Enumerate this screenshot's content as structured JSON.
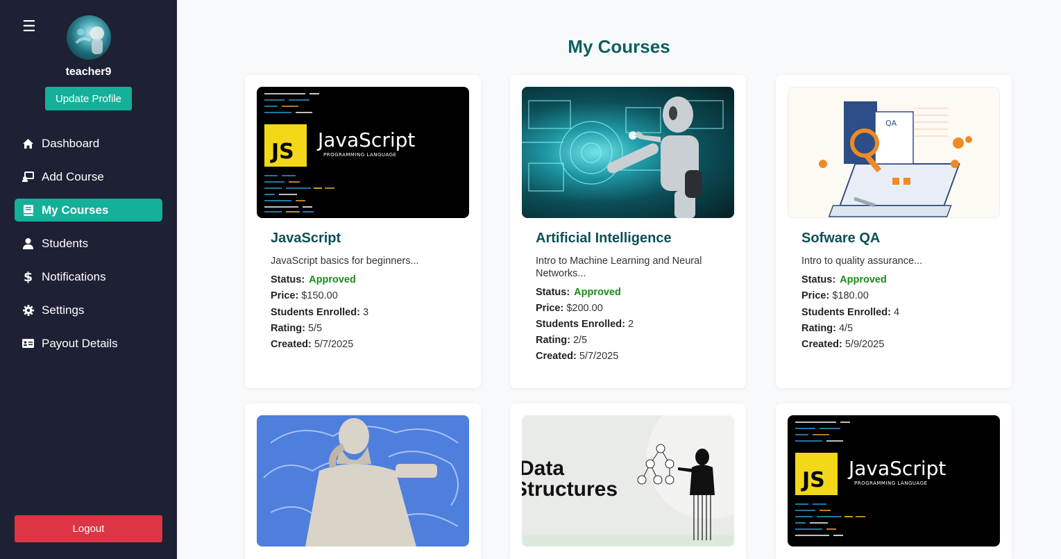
{
  "sidebar": {
    "username": "teacher9",
    "update_profile": "Update Profile",
    "items": [
      {
        "label": "Dashboard",
        "icon": "home-icon"
      },
      {
        "label": "Add Course",
        "icon": "add-course-icon"
      },
      {
        "label": "My Courses",
        "icon": "book-icon",
        "active": true
      },
      {
        "label": "Students",
        "icon": "user-icon"
      },
      {
        "label": "Notifications",
        "icon": "dollar-icon"
      },
      {
        "label": "Settings",
        "icon": "gear-icon"
      },
      {
        "label": "Payout Details",
        "icon": "id-card-icon"
      }
    ],
    "logout": "Logout"
  },
  "main": {
    "title": "My Courses",
    "labels": {
      "status": "Status:",
      "price": "Price:",
      "students": "Students Enrolled:",
      "rating": "Rating:",
      "created": "Created:"
    },
    "courses": [
      {
        "title": "JavaScript",
        "description": "JavaScript basics for beginners...",
        "status": "Approved",
        "price": "$150.00",
        "students": "3",
        "rating": "5/5",
        "created": "5/7/2025",
        "thumbnail": "javascript-banner"
      },
      {
        "title": "Artificial Intelligence",
        "description": "Intro to Machine Learning and Neural Networks...",
        "status": "Approved",
        "price": "$200.00",
        "students": "2",
        "rating": "2/5",
        "created": "5/7/2025",
        "thumbnail": "ai-robot-image"
      },
      {
        "title": "Sofware QA",
        "description": "Intro to quality assurance...",
        "status": "Approved",
        "price": "$180.00",
        "students": "4",
        "rating": "4/5",
        "created": "5/9/2025",
        "thumbnail": "qa-illustration"
      }
    ],
    "thumb_texts": {
      "js_title": "JavaScript",
      "js_sub": "PROGRAMMING LANGUAGE",
      "js_badge": "JS",
      "ds_line1": "Data",
      "ds_line2": "Structures"
    }
  },
  "colors": {
    "sidebar_bg": "#1e2034",
    "accent": "#14b09a",
    "title": "#0e5e63",
    "approved": "#1c8a1c",
    "logout": "#dc3545"
  }
}
